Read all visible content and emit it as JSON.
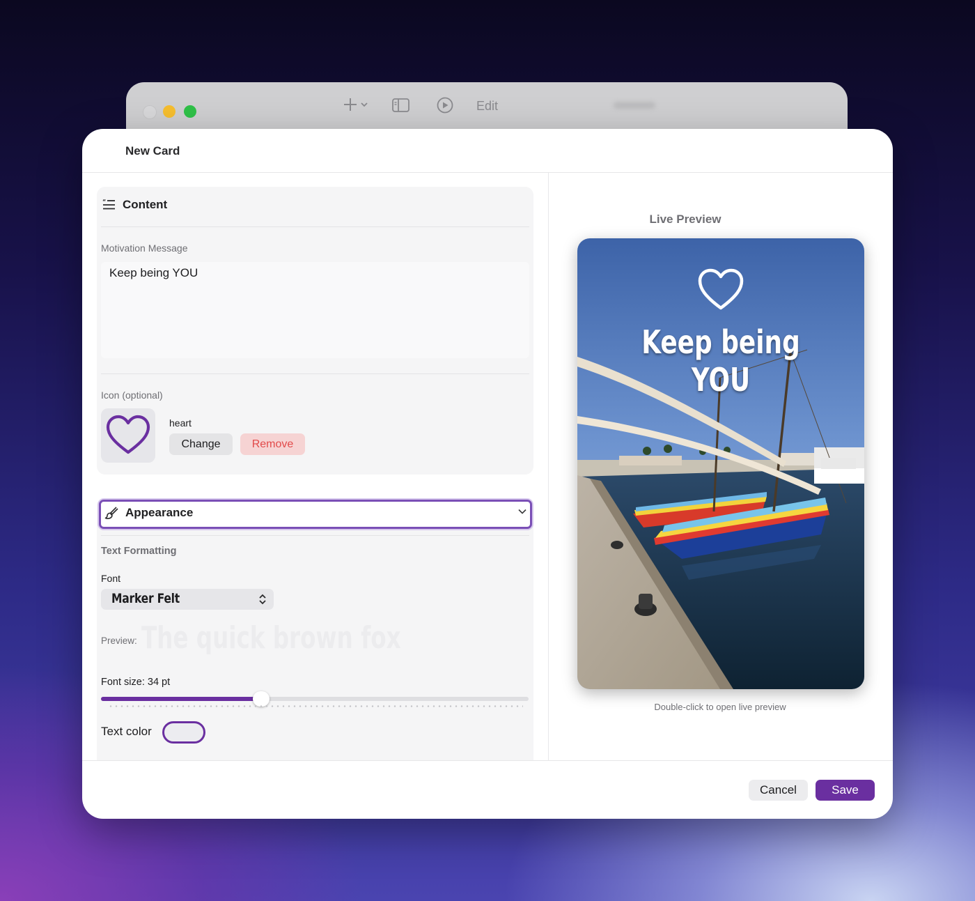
{
  "background_window": {
    "toolbar": {
      "add_icon": "plus-icon",
      "sidebar_icon": "sidebar-toggle-icon",
      "play_icon": "play-circle-icon",
      "edit_label": "Edit"
    }
  },
  "dialog": {
    "title": "New Card",
    "content": {
      "header_label": "Content",
      "header_icon": "text-quote-icon",
      "message_label": "Motivation Message",
      "message_value": "Keep being YOU",
      "icon_label": "Icon (optional)",
      "icon_name": "heart",
      "change_label": "Change",
      "remove_label": "Remove"
    },
    "appearance": {
      "header_label": "Appearance",
      "header_icon": "paintbrush-icon",
      "expanded": true,
      "section_label": "Text Formatting",
      "font_label": "Font",
      "font_value": "Marker Felt",
      "preview_label": "Preview:",
      "preview_sample": "The quick brown fox",
      "font_size_label": "Font size: 34 pt",
      "font_size_fraction": 0.375,
      "text_color_label": "Text color"
    },
    "live_preview": {
      "title": "Live Preview",
      "card_message": "Keep being YOU",
      "card_icon": "heart-icon",
      "hint": "Double-click to open live preview"
    },
    "footer": {
      "cancel_label": "Cancel",
      "save_label": "Save"
    }
  },
  "colors": {
    "accent": "#6a2fa0",
    "remove_bg": "#f6d3d3",
    "remove_text": "#e24a4a",
    "traffic_min": "#f6be2f",
    "traffic_max": "#2fc148"
  }
}
